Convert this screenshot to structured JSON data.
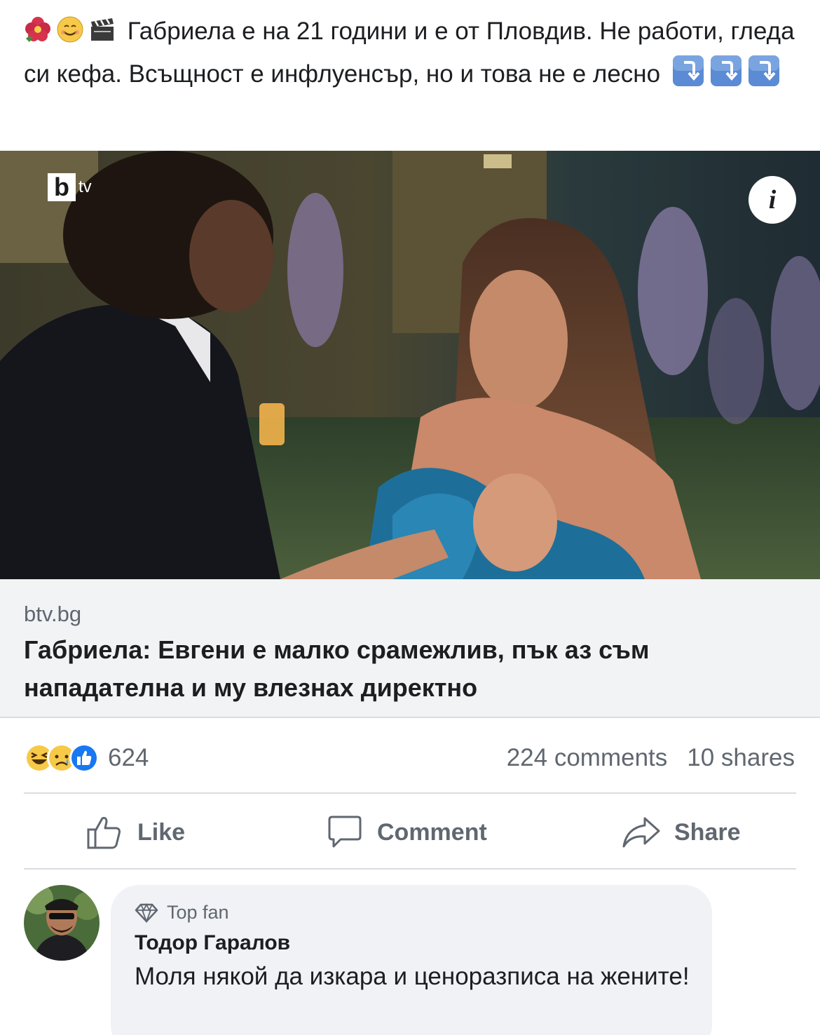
{
  "post": {
    "text": "Габриела е на 21 години и е от Пловдив. Не работи, гледа си кефа. Всъщност е инфлуенсър, но и това не е лесно",
    "emojis": [
      "hibiscus-icon",
      "smiling-face-icon",
      "clapper-board-icon"
    ],
    "trailing_icons": [
      "arrow-down-box-icon",
      "arrow-down-box-icon",
      "arrow-down-box-icon"
    ]
  },
  "media": {
    "channel_logo": {
      "b": "b",
      "tv": "tv"
    },
    "info_label": "i"
  },
  "link": {
    "domain": "btv.bg",
    "title": "Габриела: Евгени е малко срамежлив, пък аз съм нападателна и му влезнах директно"
  },
  "reactions": {
    "icons": [
      "haha-icon",
      "sad-icon",
      "like-icon"
    ],
    "count": "624",
    "comments": "224 comments",
    "shares": "10 shares"
  },
  "actions": {
    "like": "Like",
    "comment": "Comment",
    "share": "Share"
  },
  "comment": {
    "badge": "Top fan",
    "author": "Тодор Гаралов",
    "text": "Моля някой да изкара и ценоразписа на жените!"
  },
  "colors": {
    "text_primary": "#1c1e21",
    "text_secondary": "#606770",
    "link_card_bg": "#f2f3f5",
    "comment_bg": "#f0f2f5",
    "like_blue": "#1877f2",
    "reaction_yellow": "#f7c948"
  }
}
